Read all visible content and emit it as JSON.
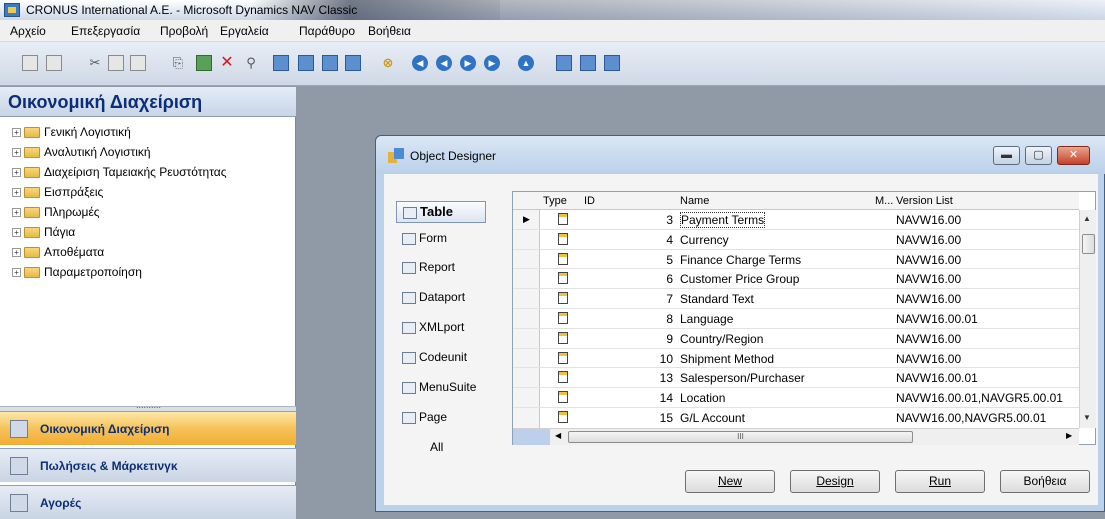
{
  "window": {
    "title": "CRONUS International A.E. - Microsoft Dynamics NAV Classic"
  },
  "menu": [
    "Αρχείο",
    "Επεξεργασία",
    "Προβολή",
    "Εργαλεία",
    "Παράθυρο",
    "Βοήθεια"
  ],
  "toolbar_icons": [
    "print-icon",
    "preview-icon",
    "cut-icon",
    "copy-icon",
    "paste-icon",
    "attach-icon",
    "new-icon",
    "delete-icon",
    "find-icon",
    "table-icon",
    "form-icon",
    "report-icon",
    "list-icon",
    "binoculars-icon",
    "first-record-icon",
    "previous-record-icon",
    "next-record-icon",
    "last-record-icon",
    "eject-icon",
    "card-icon",
    "zoom-icon",
    "help-icon"
  ],
  "nav": {
    "title": "Οικονομική Διαχείριση",
    "tree": [
      "Γενική Λογιστική",
      "Αναλυτική Λογιστική",
      "Διαχείριση Ταμειακής Ρευστότητας",
      "Εισπράξεις",
      "Πληρωμές",
      "Πάγια",
      "Αποθέματα",
      "Παραμετροποίηση"
    ],
    "splitter_grip": "..........",
    "buttons": [
      "Οικονομική Διαχείριση",
      "Πωλήσεις & Μάρκετινγκ",
      "Αγορές"
    ]
  },
  "object_designer": {
    "title": "Object Designer",
    "types": [
      "Table",
      "Form",
      "Report",
      "Dataport",
      "XMLport",
      "Codeunit",
      "MenuSuite",
      "Page",
      "All"
    ],
    "columns": {
      "type": "Type",
      "id": "ID",
      "name": "Name",
      "modified": "M...",
      "version": "Version List"
    },
    "rows": [
      {
        "id": "3",
        "name": "Payment Terms",
        "version": "NAVW16.00"
      },
      {
        "id": "4",
        "name": "Currency",
        "version": "NAVW16.00"
      },
      {
        "id": "5",
        "name": "Finance Charge Terms",
        "version": "NAVW16.00"
      },
      {
        "id": "6",
        "name": "Customer Price Group",
        "version": "NAVW16.00"
      },
      {
        "id": "7",
        "name": "Standard Text",
        "version": "NAVW16.00"
      },
      {
        "id": "8",
        "name": "Language",
        "version": "NAVW16.00.01"
      },
      {
        "id": "9",
        "name": "Country/Region",
        "version": "NAVW16.00"
      },
      {
        "id": "10",
        "name": "Shipment Method",
        "version": "NAVW16.00"
      },
      {
        "id": "13",
        "name": "Salesperson/Purchaser",
        "version": "NAVW16.00.01"
      },
      {
        "id": "14",
        "name": "Location",
        "version": "NAVW16.00.01,NAVGR5.00.01"
      },
      {
        "id": "15",
        "name": "G/L Account",
        "version": "NAVW16.00,NAVGR5.00.01"
      }
    ],
    "buttons": {
      "new": "New",
      "design": "Design",
      "run": "Run",
      "help": "Βοήθεια"
    }
  }
}
